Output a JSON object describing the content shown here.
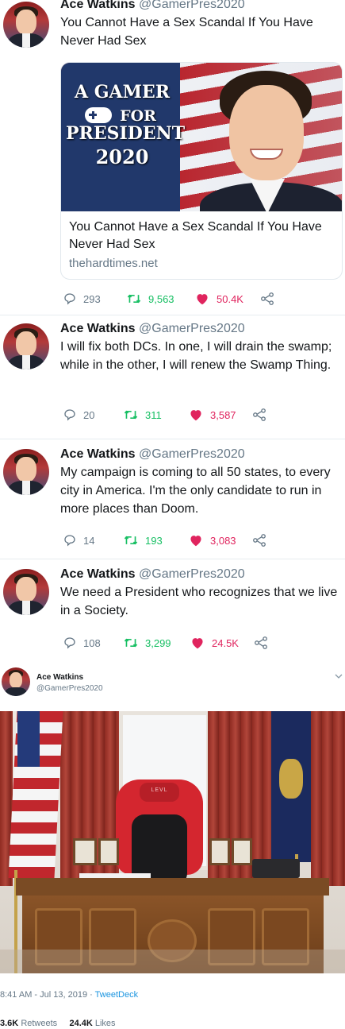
{
  "tweets": [
    {
      "name": "Ace Watkins",
      "handle": "@GamerPres2020",
      "text": "You Cannot Have a Sex Scandal If You Have Never Had Sex",
      "card": {
        "image_line1": "A GAMER",
        "image_line2": "FOR",
        "image_line3": "PRESIDENT",
        "image_line4": "2020",
        "title": "You Cannot Have a Sex Scandal If You Have Never Had Sex",
        "domain": "thehardtimes.net"
      },
      "replies": "293",
      "retweets": "9,563",
      "likes": "50.4K"
    },
    {
      "name": "Ace Watkins",
      "handle": "@GamerPres2020",
      "text": "I will fix both DCs. In one, I will drain the swamp; while in the other, I will renew the Swamp Thing.",
      "replies": "20",
      "retweets": "311",
      "likes": "3,587"
    },
    {
      "name": "Ace Watkins",
      "handle": "@GamerPres2020",
      "text": "My campaign is coming to all 50 states, to every city in America. I'm the only candidate to run in more places than Doom.",
      "replies": "14",
      "retweets": "193",
      "likes": "3,083"
    },
    {
      "name": "Ace Watkins",
      "handle": "@GamerPres2020",
      "text": "We need a President who recognizes that we live in a Society.",
      "replies": "108",
      "retweets": "3,299",
      "likes": "24.5K"
    }
  ],
  "embed": {
    "name": "Ace Watkins",
    "handle": "@GamerPres2020",
    "chair_logo": "LEVL",
    "timestamp": "8:41 AM - Jul 13, 2019 · ",
    "source": "TweetDeck",
    "retweets_count": "3.6K",
    "retweets_label": "Retweets",
    "likes_count": "24.4K",
    "likes_label": "Likes"
  },
  "colors": {
    "text": "#14171a",
    "muted": "#657786",
    "retweet": "#17bf63",
    "like": "#e0245e",
    "link": "#1b95e0",
    "divider": "#e6ecf0"
  },
  "icons": [
    "reply-icon",
    "retweet-icon",
    "heart-icon",
    "share-icon",
    "chevron-down-icon"
  ]
}
